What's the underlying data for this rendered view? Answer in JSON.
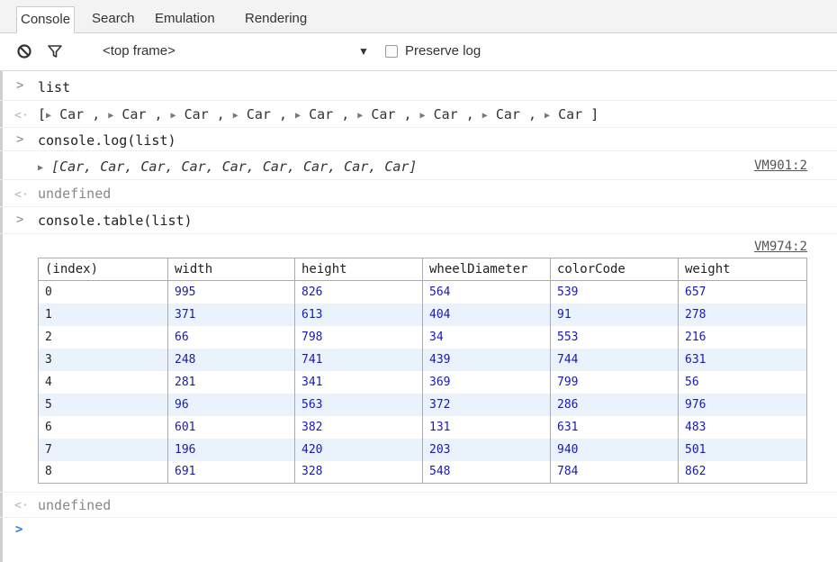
{
  "tabs": [
    {
      "label": "Console",
      "active": true
    },
    {
      "label": "Search",
      "active": false
    },
    {
      "label": "Emulation",
      "active": false
    },
    {
      "label": "Rendering",
      "active": false
    }
  ],
  "toolbar": {
    "clear_icon": "no-entry-icon",
    "filter_icon": "funnel-icon",
    "frame": "<top frame>",
    "dropdown_arrow": "▼",
    "preserve_log_label": "Preserve log",
    "preserve_log_checked": false
  },
  "console": {
    "cmd1": "list",
    "array_open": "[",
    "array_items": [
      "Car",
      "Car",
      "Car",
      "Car",
      "Car",
      "Car",
      "Car",
      "Car",
      "Car"
    ],
    "array_close": "]",
    "cmd2": "console.log(list)",
    "log_output": "[Car, Car, Car, Car, Car, Car, Car, Car, Car]",
    "log_source": "VM901:2",
    "result1": "undefined",
    "cmd3": "console.table(list)",
    "table_source": "VM974:2",
    "result2": "undefined"
  },
  "table": {
    "headers": [
      "(index)",
      "width",
      "height",
      "wheelDiameter",
      "colorCode",
      "weight"
    ],
    "rows": [
      [
        "0",
        "995",
        "826",
        "564",
        "539",
        "657"
      ],
      [
        "1",
        "371",
        "613",
        "404",
        "91",
        "278"
      ],
      [
        "2",
        "66",
        "798",
        "34",
        "553",
        "216"
      ],
      [
        "3",
        "248",
        "741",
        "439",
        "744",
        "631"
      ],
      [
        "4",
        "281",
        "341",
        "369",
        "799",
        "56"
      ],
      [
        "5",
        "96",
        "563",
        "372",
        "286",
        "976"
      ],
      [
        "6",
        "601",
        "382",
        "131",
        "631",
        "483"
      ],
      [
        "7",
        "196",
        "420",
        "203",
        "940",
        "501"
      ],
      [
        "8",
        "691",
        "328",
        "548",
        "784",
        "862"
      ]
    ]
  },
  "colors": {
    "prompt_blue": "#2f7fd3",
    "number_blue": "#1a1aa6",
    "row_stripe": "#eaf2fc"
  }
}
